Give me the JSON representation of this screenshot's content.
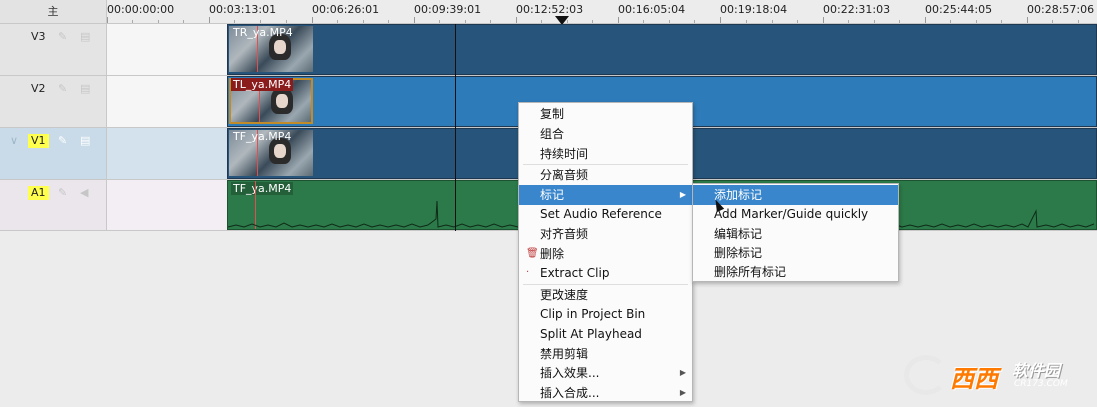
{
  "header": {
    "project_label": "主"
  },
  "ruler": {
    "timecodes": [
      "00:00:00:00",
      "00:03:13:01",
      "00:06:26:01",
      "00:09:39:01",
      "00:12:52:03",
      "00:16:05:04",
      "00:19:18:04",
      "00:22:31:03",
      "00:25:44:05",
      "00:28:57:06"
    ]
  },
  "tracks": [
    {
      "name": "V3",
      "clip": "TR_ya.MP4",
      "color": "#27547a"
    },
    {
      "name": "V2",
      "clip": "TL_ya.MP4",
      "color": "#2e7bb9"
    },
    {
      "name": "V1",
      "clip": "TF_ya.MP4",
      "color": "#27547a"
    },
    {
      "name": "A1",
      "clip": "TF_ya.MP4",
      "color": "#2c7a49"
    }
  ],
  "context_menu": {
    "items": [
      {
        "label": "复制"
      },
      {
        "label": "组合"
      },
      {
        "label": "持续时间"
      },
      {
        "label": "分离音频"
      },
      {
        "label": "标记",
        "submenu": true
      },
      {
        "label": "Set Audio Reference"
      },
      {
        "label": "对齐音频"
      },
      {
        "label": "删除",
        "icon": "trash-icon"
      },
      {
        "label": "Extract Clip",
        "icon": "extract-icon"
      },
      {
        "label": "更改速度"
      },
      {
        "label": "Clip in Project Bin"
      },
      {
        "label": "Split At Playhead"
      },
      {
        "label": "禁用剪辑"
      },
      {
        "label": "插入效果...",
        "submenu": true
      },
      {
        "label": "插入合成...",
        "submenu": true
      }
    ]
  },
  "submenu": {
    "items": [
      {
        "label": "添加标记"
      },
      {
        "label": "Add Marker/Guide quickly"
      },
      {
        "label": "编辑标记"
      },
      {
        "label": "删除标记"
      },
      {
        "label": "删除所有标记"
      }
    ]
  },
  "watermark": {
    "brand": "西西",
    "soft": "软件园",
    "url": "CR173.COM"
  }
}
